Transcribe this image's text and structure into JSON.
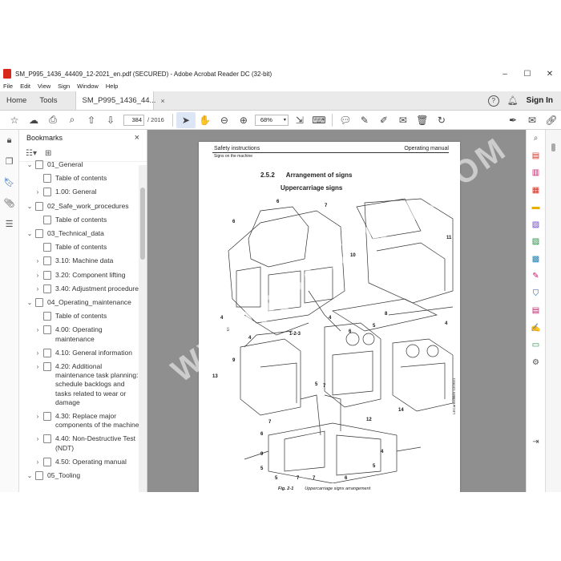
{
  "window": {
    "title": "SM_P995_1436_44409_12-2021_en.pdf (SECURED) - Adobe Acrobat Reader DC (32-bit)",
    "minimize": "–",
    "maximize": "☐",
    "close": "✕"
  },
  "menu": [
    "File",
    "Edit",
    "View",
    "Sign",
    "Window",
    "Help"
  ],
  "tabs": {
    "home": "Home",
    "tools": "Tools",
    "doc": "SM_P995_1436_44...",
    "doc_close": "×",
    "sign_in": "Sign In"
  },
  "toolbar": {
    "page_current": "384",
    "page_total": "/ 2016",
    "zoom": "68%"
  },
  "bookmarks": {
    "title": "Bookmarks",
    "close": "×",
    "items": [
      {
        "label": "01_General",
        "level": 0,
        "chev": "⌄"
      },
      {
        "label": "Table of contents",
        "level": 1,
        "chev": ""
      },
      {
        "label": "1.00: General",
        "level": 1,
        "chev": "›"
      },
      {
        "label": "02_Safe_work_procedures",
        "level": 0,
        "chev": "⌄"
      },
      {
        "label": "Table of contents",
        "level": 1,
        "chev": ""
      },
      {
        "label": "03_Technical_data",
        "level": 0,
        "chev": "⌄"
      },
      {
        "label": "Table of contents",
        "level": 1,
        "chev": ""
      },
      {
        "label": "3.10: Machine data",
        "level": 1,
        "chev": "›"
      },
      {
        "label": "3.20: Component lifting",
        "level": 1,
        "chev": "›"
      },
      {
        "label": "3.40: Adjustment procedure",
        "level": 1,
        "chev": "›"
      },
      {
        "label": "04_Operating_maintenance",
        "level": 0,
        "chev": "⌄"
      },
      {
        "label": "Table of contents",
        "level": 1,
        "chev": ""
      },
      {
        "label": "4.00: Operating maintenance",
        "level": 1,
        "chev": "›"
      },
      {
        "label": "4.10: General information",
        "level": 1,
        "chev": "›"
      },
      {
        "label": "4.20: Additional maintenance task planning: schedule backlogs and tasks related to wear or damage",
        "level": 1,
        "chev": "›"
      },
      {
        "label": "4.30: Replace major components of the machine",
        "level": 1,
        "chev": "›"
      },
      {
        "label": "4.40: Non-Destructive Test (NDT)",
        "level": 1,
        "chev": "›"
      },
      {
        "label": "4.50: Operating manual",
        "level": 1,
        "chev": "›"
      },
      {
        "label": "05_Tooling",
        "level": 0,
        "chev": "⌄"
      }
    ]
  },
  "page": {
    "header_left": "Safety instructions",
    "header_right": "Operating manual",
    "header_sub": "Signs on the machine",
    "section_num": "2.5.2",
    "section_title": "Arrangement of signs",
    "subtitle": "Uppercarriage signs",
    "fig_num": "Fig. 2-1",
    "fig_caption": "Uppercarriage signs arrangement",
    "edition": "LECarrEdition 12/2021",
    "watermark": "WWW.EPCATAPL.COM",
    "callouts": [
      "6",
      "6",
      "7",
      "4",
      "5",
      "4",
      "1-2-3",
      "10",
      "11",
      "4",
      "5",
      "8",
      "4",
      "6",
      "9",
      "13",
      "5",
      "12",
      "14",
      "7",
      "7",
      "6",
      "9",
      "5",
      "5",
      "7",
      "7",
      "6",
      "5",
      "4"
    ]
  }
}
